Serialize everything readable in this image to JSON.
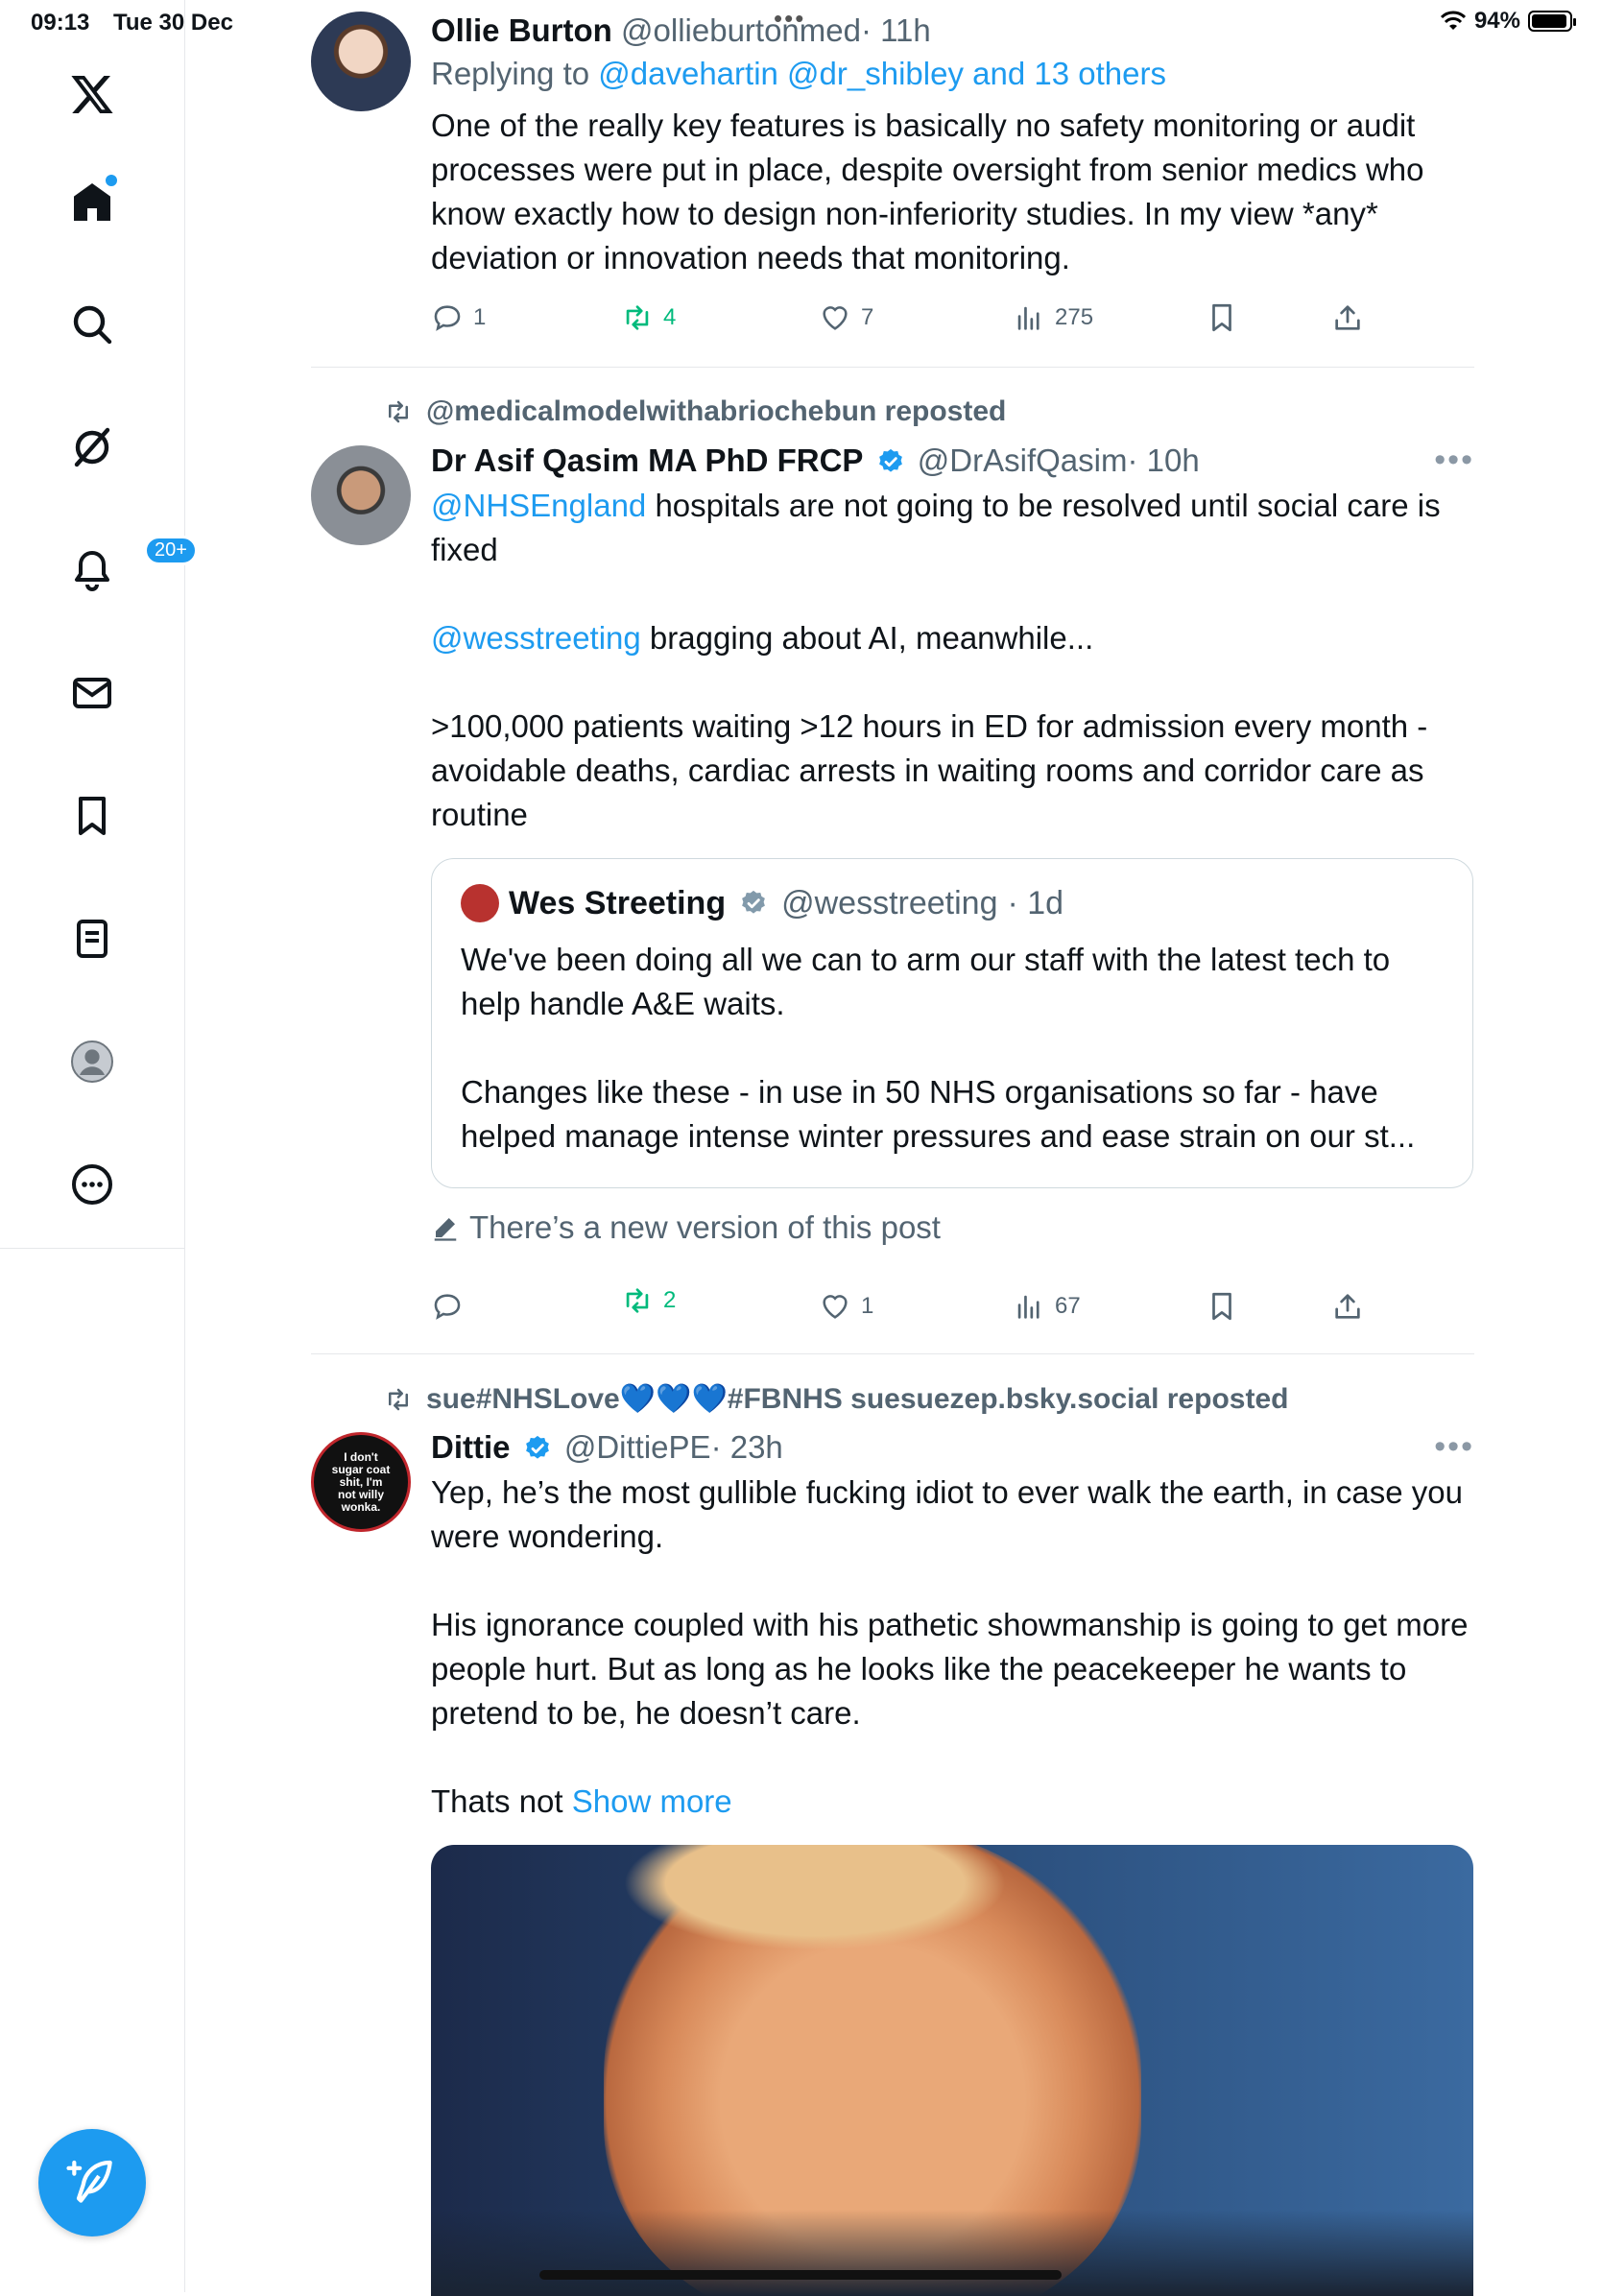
{
  "status_bar": {
    "time": "09:13",
    "date": "Tue 30 Dec",
    "battery": "94%"
  },
  "sidebar": {
    "notifications_badge": "20+",
    "items": [
      "X",
      "Home",
      "Explore",
      "Grok",
      "Notifications",
      "Messages",
      "Bookmarks",
      "Lists",
      "Profile",
      "More"
    ]
  },
  "tweets": [
    {
      "name": "Ollie Burton",
      "handle": "@ollieburtonmed",
      "time": "· 11h",
      "replying_prefix": "Replying to ",
      "replying_to": "@davehartin @dr_shibley and 13 others",
      "text": "One of the really key features is basically no safety monitoring or audit processes were put in place, despite oversight from senior medics who know exactly how to design non-inferiority studies. In my view *any* deviation or innovation needs that monitoring.",
      "replies": "1",
      "reposts": "4",
      "likes": "7",
      "views": "275"
    },
    {
      "repost_context": "@medicalmodelwithabriochebun reposted",
      "name": "Dr Asif Qasim MA PhD FRCP",
      "handle": "@DrAsifQasim",
      "time": "· 10h",
      "mention1": "@NHSEngland",
      "text1": " hospitals are not going to be resolved until social care is fixed",
      "mention2": "@wesstreeting",
      "text2": " bragging about AI, meanwhile...",
      "text3": ">100,000 patients waiting >12 hours in ED for admission every month - avoidable deaths, cardiac arrests in waiting rooms and corridor care as routine",
      "quote": {
        "name": "Wes Streeting",
        "handle": "@wesstreeting",
        "time": "· 1d",
        "text1": "We've been doing all we can to arm our staff with the latest tech to help handle A&E waits.",
        "text2": "Changes like these - in use in 50 NHS organisations so far - have helped manage intense winter pressures and ease strain on our st..."
      },
      "new_version": "There’s a new version of this post",
      "replies": "",
      "reposts": "2",
      "likes": "1",
      "views": "67"
    },
    {
      "repost_context": "sue#NHSLove💙💙💙#FBNHS suesuezep.bsky.social reposted",
      "name": "Dittie",
      "handle": "@DittiePE",
      "time": "· 23h",
      "avatar_text": "I don't sugar coat shit, I'm not willy wonka.",
      "text1": "Yep, he’s the most gullible fucking idiot to ever walk the earth, in case you were wondering.",
      "text2": "His ignorance coupled with his pathetic showmanship is going to get more people hurt. But as long as he looks like the peacekeeper he wants to pretend to be, he doesn’t care.",
      "text3": "Thats not ",
      "show_more": "Show more"
    }
  ],
  "colors": {
    "accent": "#1d9bf0",
    "repost_green": "#00ba7c",
    "secondary_text": "#536471"
  }
}
